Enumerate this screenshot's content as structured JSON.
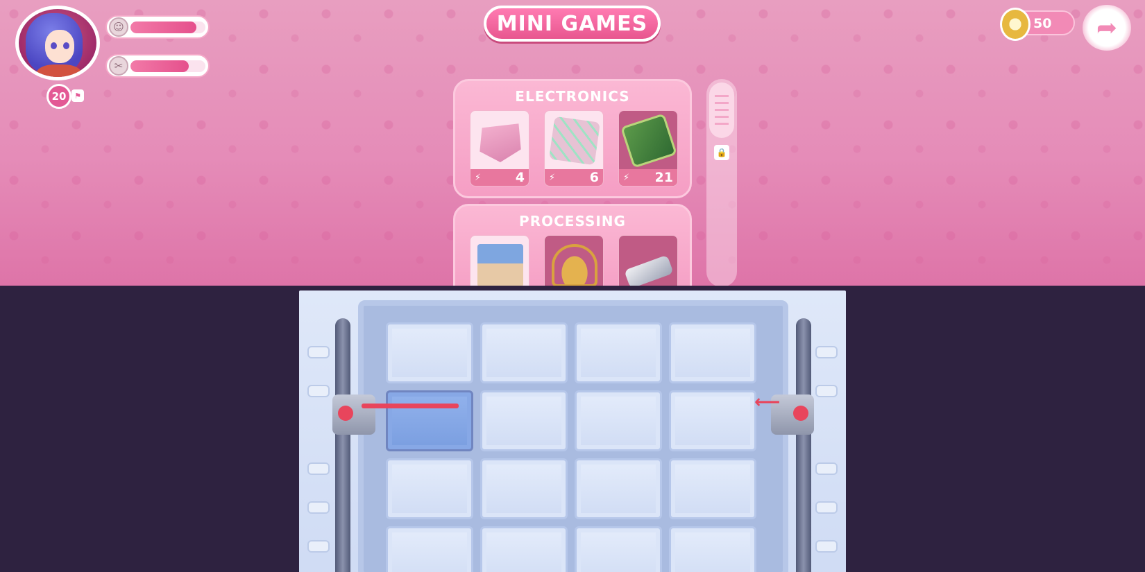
{
  "header": {
    "title": "MINI GAMES",
    "level": "20",
    "coins": "50"
  },
  "stats": [
    {
      "icon": "smile-face-icon",
      "fill": 0.88
    },
    {
      "icon": "utensils-icon",
      "fill": 0.78
    }
  ],
  "categories": [
    {
      "name": "ELECTRONICS",
      "games": [
        {
          "icon": "console-upgrade-icon",
          "cost": "4"
        },
        {
          "icon": "circuit-maze-icon",
          "cost": "6"
        },
        {
          "icon": "circuit-board-icon",
          "cost": "21"
        }
      ]
    },
    {
      "name": "PROCESSING",
      "games": [
        {
          "icon": "packages-icon"
        },
        {
          "icon": "basket-icon"
        },
        {
          "icon": "conveyor-icon"
        }
      ]
    }
  ],
  "puzzle": {
    "rows": 4,
    "cols": 4,
    "active_cell": [
      1,
      0
    ]
  },
  "colors": {
    "accent": "#e35995",
    "laser": "#e8455c",
    "background_bottom": "#2e2240"
  }
}
